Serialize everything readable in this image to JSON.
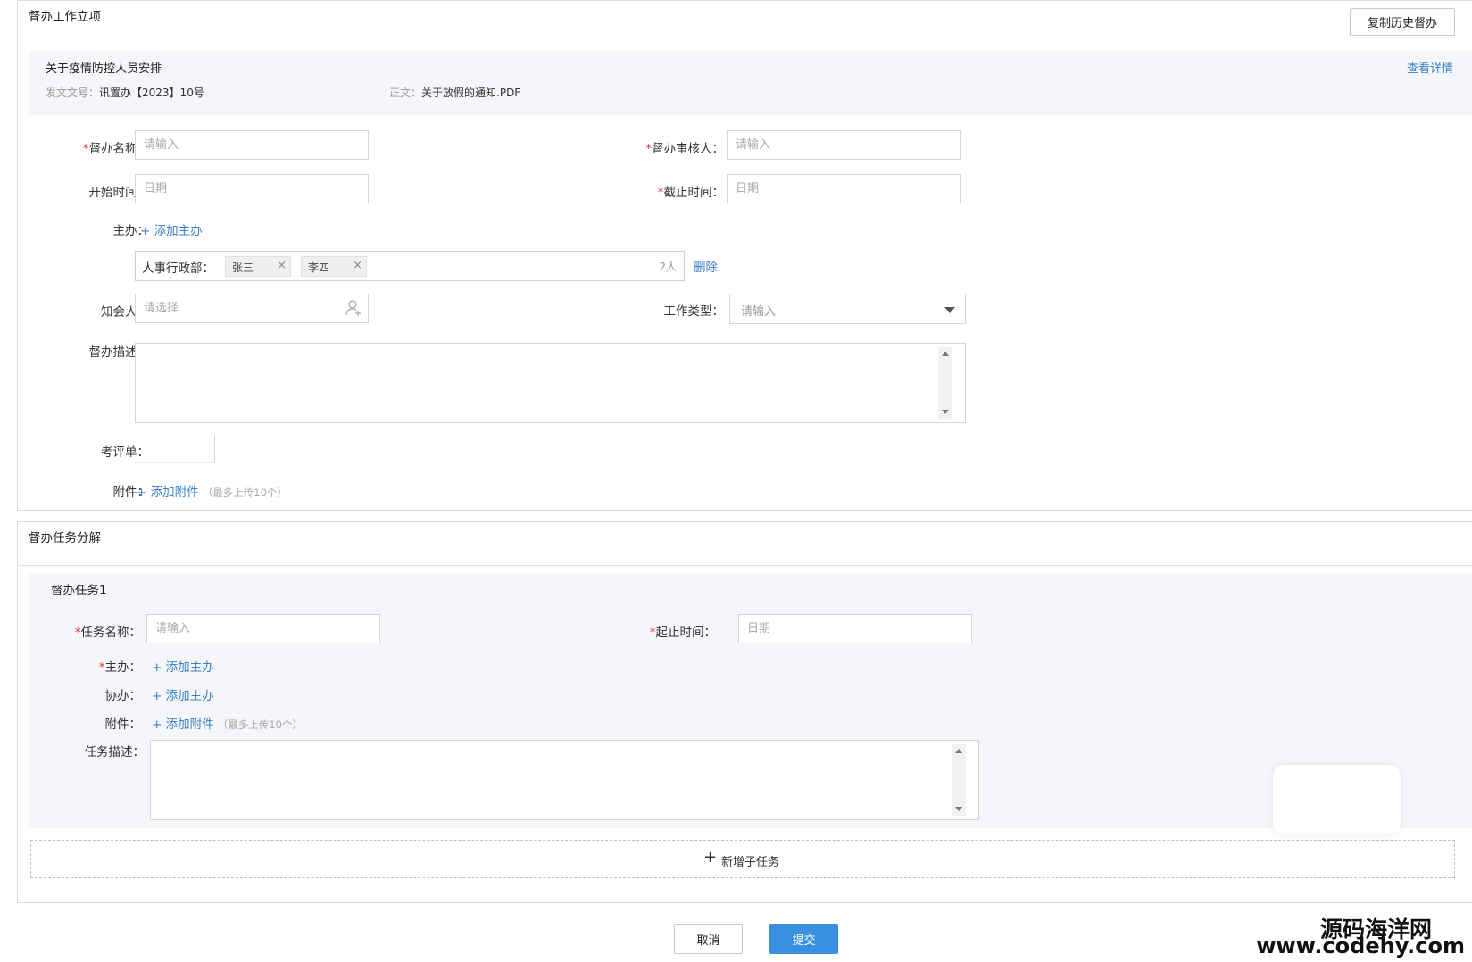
{
  "panel1": {
    "title": "督办工作立项",
    "copy_button": "复制历史督办",
    "doc": {
      "title": "关于疫情防控人员安排",
      "doc_no_label": "发文文号：",
      "doc_no_value": "讯置办【2023】10号",
      "body_label": "正文：",
      "body_value": "关于放假的通知.PDF",
      "view_link": "查看详情"
    },
    "form": {
      "name_label": "督办名称：",
      "name_placeholder": "请输入",
      "reviewer_label": "督办审核人：",
      "reviewer_placeholder": "请输入",
      "start_label": "开始时间：",
      "start_placeholder": "日期",
      "end_label": "截止时间：",
      "end_placeholder": "日期",
      "host_label": "主办：",
      "add_host": "+ 添加主办",
      "host_group": {
        "dept": "人事行政部：",
        "tags": [
          "张三",
          "李四"
        ],
        "count": "2人",
        "delete": "删除"
      },
      "cc_label": "知会人：",
      "cc_placeholder": "请选择",
      "worktype_label": "工作类型：",
      "worktype_placeholder": "请输入",
      "desc_label": "督办描述：",
      "score_label": "考评单：",
      "attach_label": "附件：",
      "add_attach": "+ 添加附件",
      "attach_hint": "（最多上传10个）"
    }
  },
  "panel2": {
    "title": "督办任务分解",
    "task": {
      "title": "督办任务1",
      "name_label": "任务名称：",
      "name_placeholder": "请输入",
      "time_label": "起止时间：",
      "time_placeholder": "日期",
      "host_label": "主办：",
      "add_host": "+ 添加主办",
      "co_label": "协办：",
      "add_co": "+ 添加主办",
      "attach_label": "附件：",
      "add_attach": "+ 添加附件",
      "attach_hint": "（最多上传10个）",
      "desc_label": "任务描述："
    },
    "add_subtask": "新增子任务"
  },
  "footer": {
    "cancel": "取消",
    "submit": "提交"
  },
  "watermark": {
    "line1": "源码海洋网",
    "line2": "www.codehy.com"
  },
  "colors": {
    "link": "#3b82c4",
    "primary": "#3b8fe0",
    "required": "#e53935",
    "section_bg": "#f4f6f9"
  }
}
